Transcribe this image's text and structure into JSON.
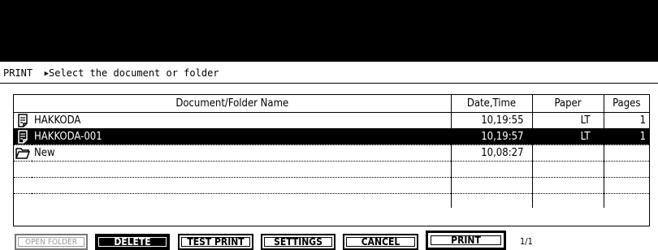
{
  "header": {
    "mode": "PRINT",
    "arrow": "▶",
    "instruction": "Select the document or folder"
  },
  "table": {
    "columns": {
      "name": "Document/Folder Name",
      "date": "Date,Time",
      "paper": "Paper",
      "pages": "Pages"
    },
    "rows": [
      {
        "icon": "document-icon",
        "name": "HAKKODA",
        "date": "10,19:55",
        "paper": "LT",
        "pages": "1",
        "selected": false
      },
      {
        "icon": "document-icon",
        "name": "HAKKODA-001",
        "date": "10,19:57",
        "paper": "LT",
        "pages": "1",
        "selected": true
      },
      {
        "icon": "folder-icon",
        "name": "New",
        "date": "10,08:27",
        "paper": "",
        "pages": "",
        "selected": false
      }
    ]
  },
  "buttons": {
    "open_folder": "OPEN FOLDER",
    "delete": "DELETE",
    "test_print": "TEST PRINT",
    "settings": "SETTINGS",
    "cancel": "CANCEL",
    "print": "PRINT"
  },
  "page_indicator": "1/1"
}
